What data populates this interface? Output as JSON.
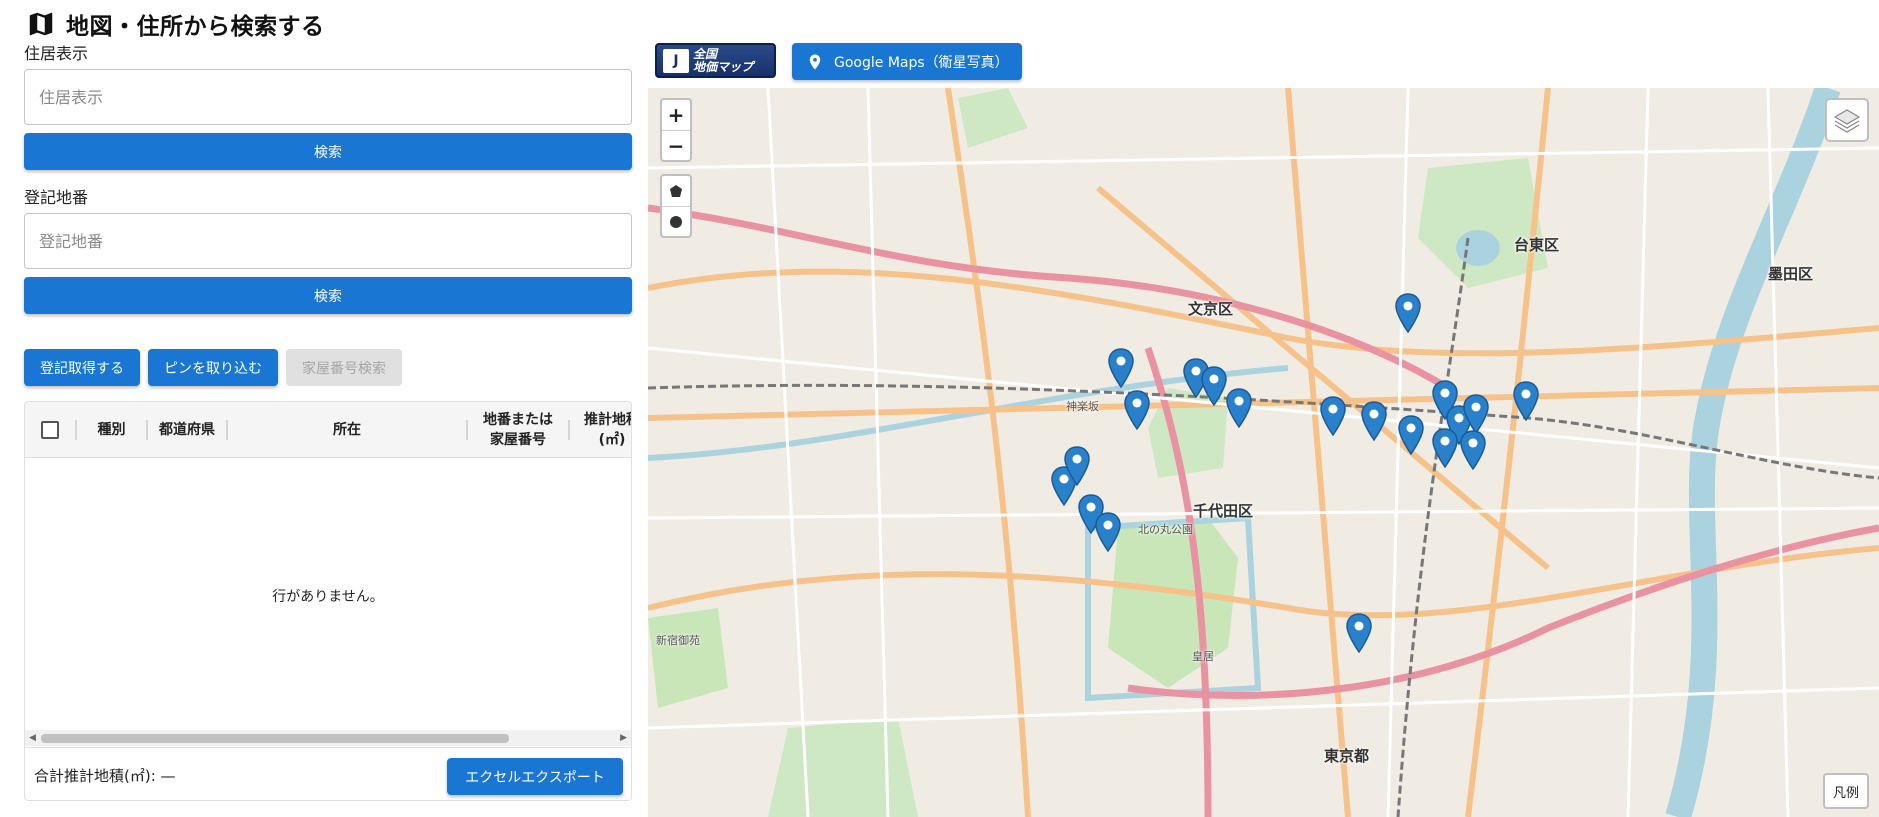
{
  "header": {
    "title": "地図・住所から検索する",
    "icon": "map-icon"
  },
  "search": {
    "address_label": "住居表示",
    "address_placeholder": "住居表示",
    "address_button": "検索",
    "parcel_label": "登記地番",
    "parcel_placeholder": "登記地番",
    "parcel_button": "検索"
  },
  "actions": {
    "get_registry": "登記取得する",
    "import_pins": "ピンを取り込む",
    "house_number_search": "家屋番号検索"
  },
  "grid": {
    "columns": [
      "種別",
      "都道府県",
      "所在",
      "地番または\n家屋番号",
      "推計地積\n(㎡)"
    ],
    "empty_message": "行がありません。",
    "total_label": "合計推計地積(㎡): —",
    "export_button": "エクセルエクスポート"
  },
  "map_toolbar": {
    "logo_line1": "全国",
    "logo_line2": "地価マップ",
    "google_maps_button": "Google Maps（衛星写真）"
  },
  "map": {
    "zoom_in": "+",
    "zoom_out": "−",
    "legend_button": "凡例",
    "labels": [
      "文京区",
      "千代田区",
      "台東区",
      "墨田区",
      "東京都",
      "皇居",
      "神楽坂",
      "北の丸公園",
      "新宿御苑"
    ],
    "pin_color": "#2a81cb"
  },
  "colors": {
    "primary": "#1976d2",
    "disabled_bg": "#e0e0e0",
    "disabled_text": "#a6a6a6"
  }
}
